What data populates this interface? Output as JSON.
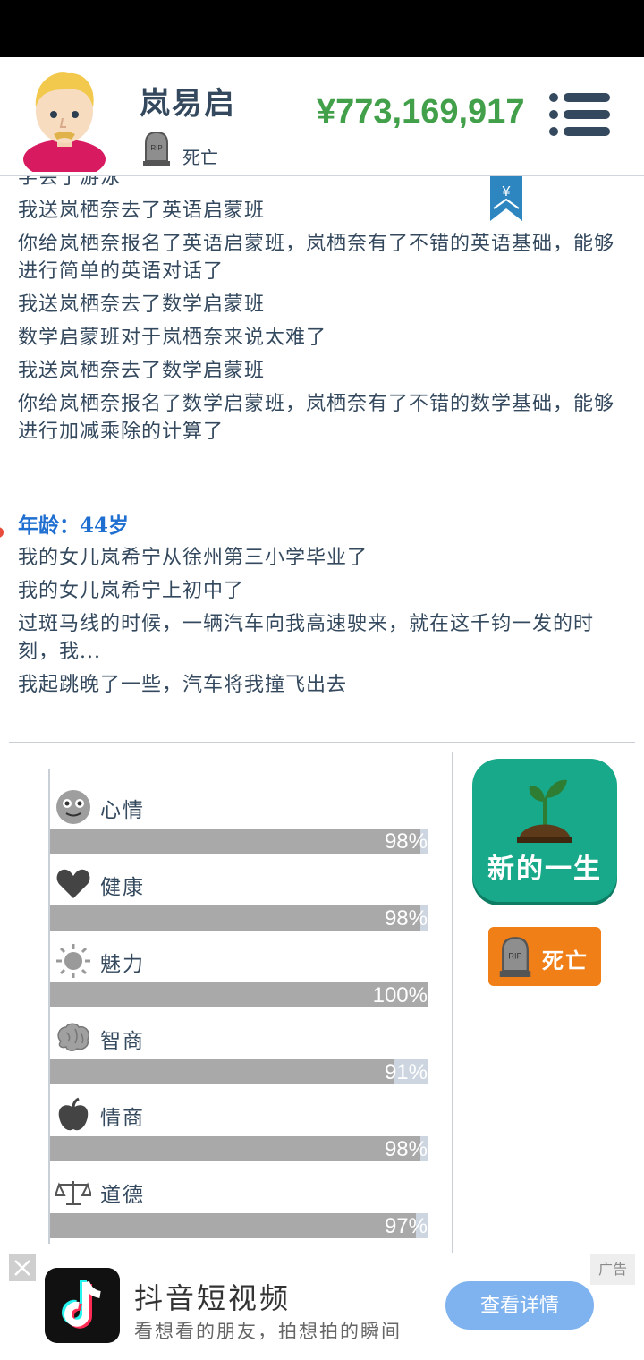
{
  "header": {
    "name": "岚易启",
    "status": "死亡",
    "money": "¥773,169,917"
  },
  "log": {
    "lines_top": [
      "学会了游泳",
      "我送岚栖奈去了英语启蒙班",
      "你给岚栖奈报名了英语启蒙班，岚栖奈有了不错的英语基础，能够进行简单的英语对话了",
      "我送岚栖奈去了数学启蒙班",
      "数学启蒙班对于岚栖奈来说太难了",
      "我送岚栖奈去了数学启蒙班",
      "你给岚栖奈报名了数学启蒙班，岚栖奈有了不错的数学基础，能够进行加减乘除的计算了"
    ],
    "age_label": "年龄：44岁",
    "lines_bottom": [
      "我的女儿岚希宁从徐州第三小学毕业了",
      "我的女儿岚希宁上初中了",
      "过斑马线的时候，一辆汽车向我高速驶来，就在这千钧一发的时刻，我...",
      "我起跳晚了一些，汽车将我撞飞出去"
    ]
  },
  "stats": [
    {
      "label": "心情",
      "value": 98,
      "text": "98%",
      "icon": "face-icon"
    },
    {
      "label": "健康",
      "value": 98,
      "text": "98%",
      "icon": "heart-icon"
    },
    {
      "label": "魅力",
      "value": 100,
      "text": "100%",
      "icon": "sun-icon"
    },
    {
      "label": "智商",
      "value": 91,
      "text": "91%",
      "icon": "brain-icon"
    },
    {
      "label": "情商",
      "value": 98,
      "text": "98%",
      "icon": "apple-icon"
    },
    {
      "label": "道德",
      "value": 97,
      "text": "97%",
      "icon": "scale-icon"
    }
  ],
  "actions": {
    "new_life": "新的一生",
    "death": "死亡"
  },
  "ad": {
    "tag": "广告",
    "title": "抖音短视频",
    "subtitle": "看想看的朋友，拍想拍的瞬间",
    "button": "查看详情"
  },
  "colors": {
    "money": "#43a04a",
    "age": "#1f6fd1",
    "new_life_bg": "#17a98a",
    "death_btn_bg": "#f07f17",
    "ad_button": "#7fb3ef"
  }
}
